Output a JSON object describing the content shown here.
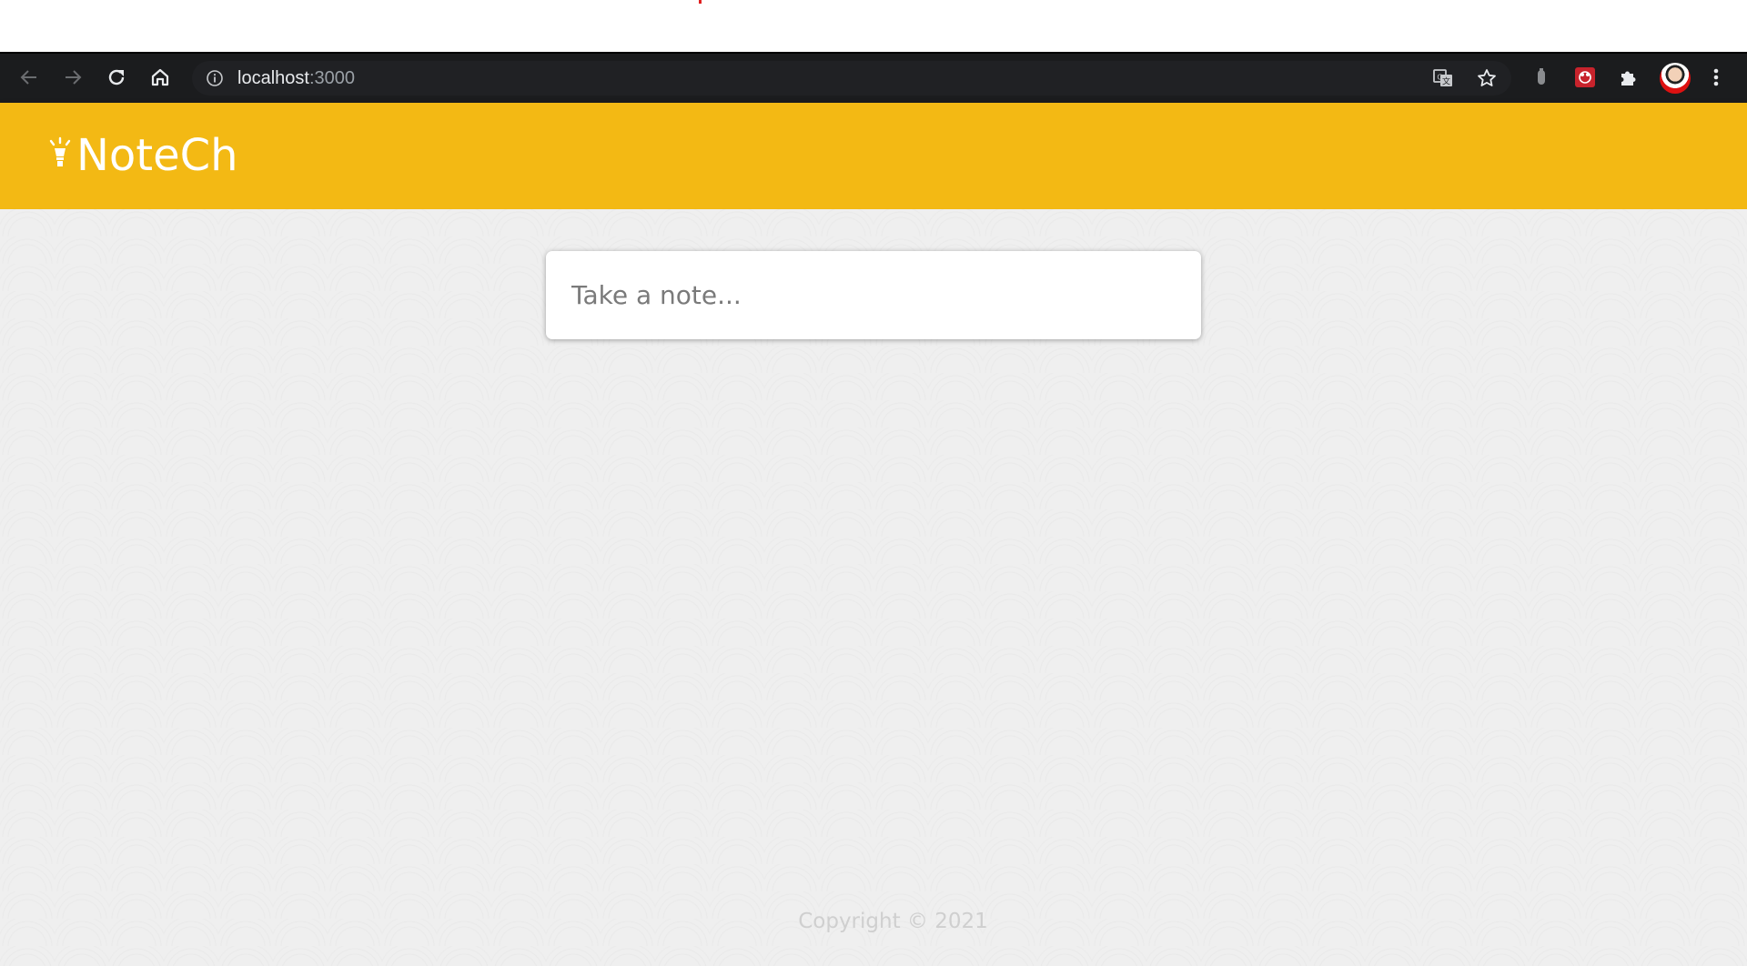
{
  "browser": {
    "url_host": "localhost",
    "url_port": ":3000",
    "icons": [
      "back-icon",
      "forward-icon",
      "reload-icon",
      "home-icon",
      "info-icon",
      "translate-icon",
      "star-icon",
      "extension-icon",
      "extensions-puzzle-icon",
      "avatar",
      "menu-icon"
    ]
  },
  "app": {
    "brand_name": "NoteCh",
    "brand_color": "#f3b914"
  },
  "note": {
    "placeholder": "Take a note..."
  },
  "footer": {
    "text": "Copyright © 2021"
  }
}
